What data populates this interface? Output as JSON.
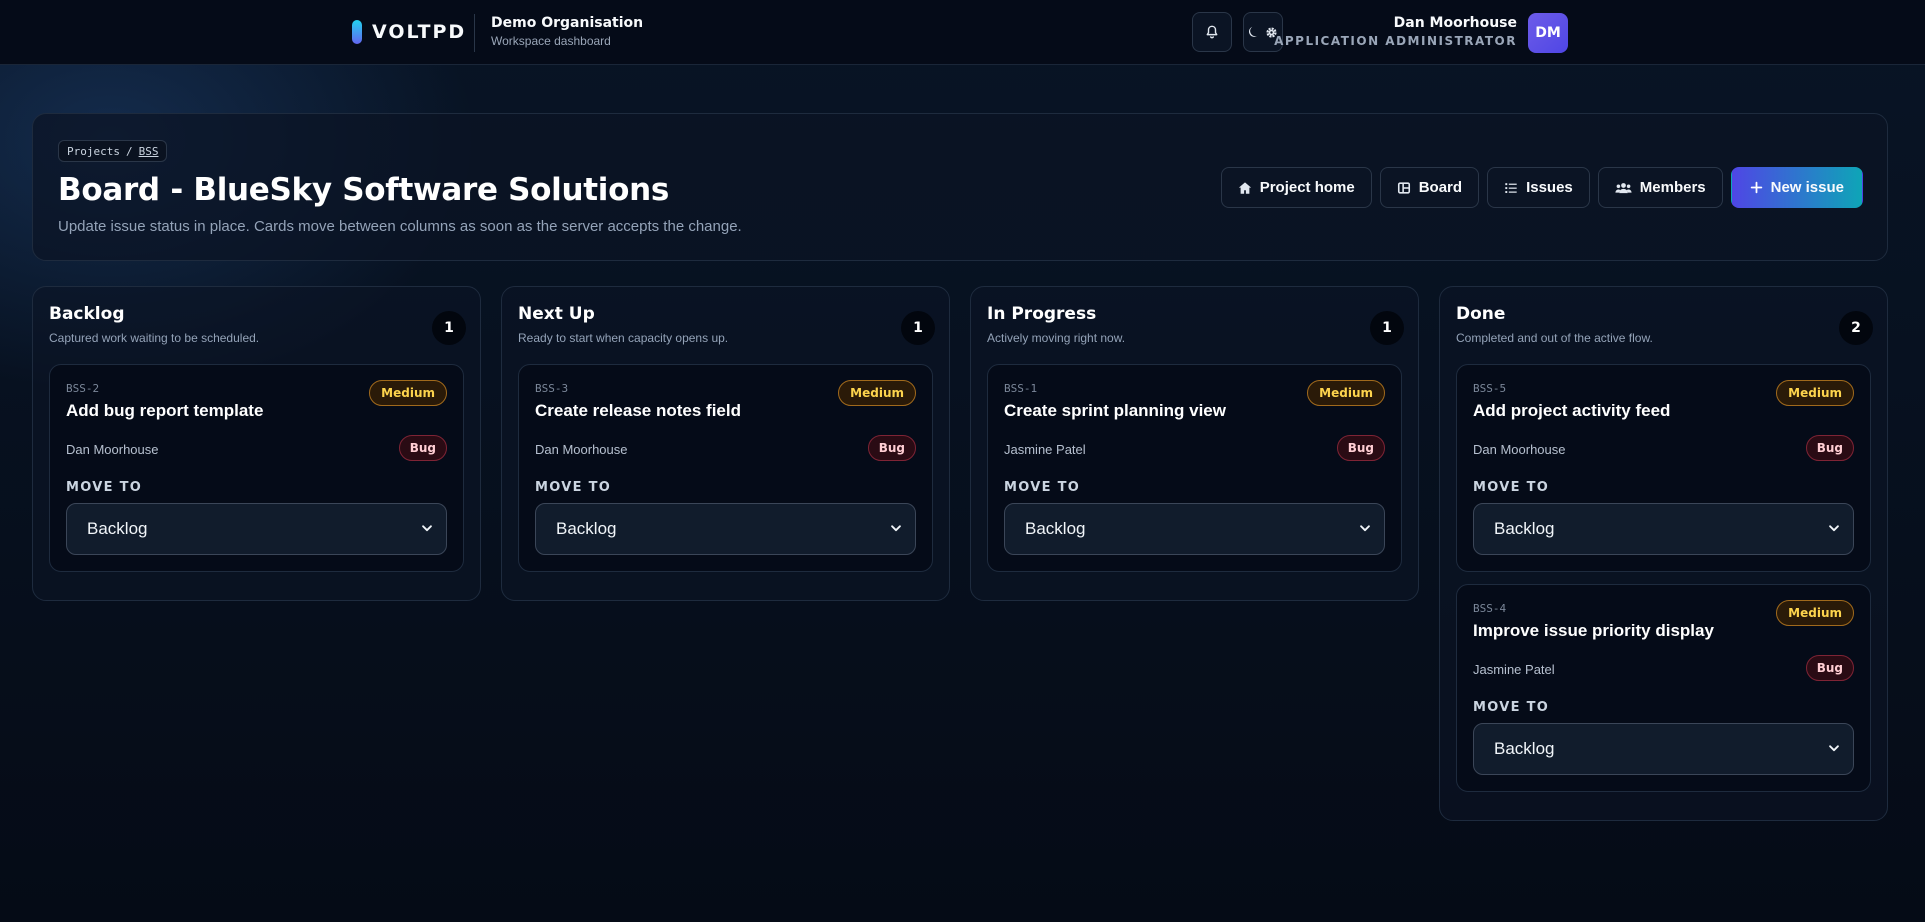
{
  "topbar": {
    "brand": "VOLTPD",
    "org_name": "Demo Organisation",
    "org_sub": "Workspace dashboard",
    "notifications_icon": "bell-icon",
    "theme_icon": "moon-gear-icon",
    "user_name": "Dan Moorhouse",
    "user_role": "APPLICATION ADMINISTRATOR",
    "avatar_initials": "DM"
  },
  "header": {
    "breadcrumb_root": "Projects",
    "breadcrumb_sep": "/",
    "breadcrumb_current": "BSS",
    "title": "Board - BlueSky Software Solutions",
    "subtitle": "Update issue status in place. Cards move between columns as soon as the server accepts the change.",
    "actions": [
      {
        "label": "Project home",
        "icon": "home-icon"
      },
      {
        "label": "Board",
        "icon": "board-icon"
      },
      {
        "label": "Issues",
        "icon": "list-icon"
      },
      {
        "label": "Members",
        "icon": "users-icon"
      },
      {
        "label": "New issue",
        "icon": "plus-icon"
      }
    ]
  },
  "columns": [
    {
      "title": "Backlog",
      "description": "Captured work waiting to be scheduled.",
      "count": "1",
      "cards": [
        {
          "key": "BSS-2",
          "title": "Add bug report template",
          "priority": "Medium",
          "assignee": "Dan Moorhouse",
          "type": "Bug",
          "move_label": "MOVE TO",
          "move_value": "Backlog"
        }
      ]
    },
    {
      "title": "Next Up",
      "description": "Ready to start when capacity opens up.",
      "count": "1",
      "cards": [
        {
          "key": "BSS-3",
          "title": "Create release notes field",
          "priority": "Medium",
          "assignee": "Dan Moorhouse",
          "type": "Bug",
          "move_label": "MOVE TO",
          "move_value": "Backlog"
        }
      ]
    },
    {
      "title": "In Progress",
      "description": "Actively moving right now.",
      "count": "1",
      "cards": [
        {
          "key": "BSS-1",
          "title": "Create sprint planning view",
          "priority": "Medium",
          "assignee": "Jasmine Patel",
          "type": "Bug",
          "move_label": "MOVE TO",
          "move_value": "Backlog"
        }
      ]
    },
    {
      "title": "Done",
      "description": "Completed and out of the active flow.",
      "count": "2",
      "cards": [
        {
          "key": "BSS-5",
          "title": "Add project activity feed",
          "priority": "Medium",
          "assignee": "Dan Moorhouse",
          "type": "Bug",
          "move_label": "MOVE TO",
          "move_value": "Backlog"
        },
        {
          "key": "BSS-4",
          "title": "Improve issue priority display",
          "priority": "Medium",
          "assignee": "Jasmine Patel",
          "type": "Bug",
          "move_label": "MOVE TO",
          "move_value": "Backlog"
        }
      ]
    }
  ],
  "colors": {
    "accent_start": "#4f46e5",
    "accent_end": "#0ea5b7",
    "priority_medium": "#fcd34d",
    "type_bug": "#fecdd3",
    "background": "#071120"
  }
}
